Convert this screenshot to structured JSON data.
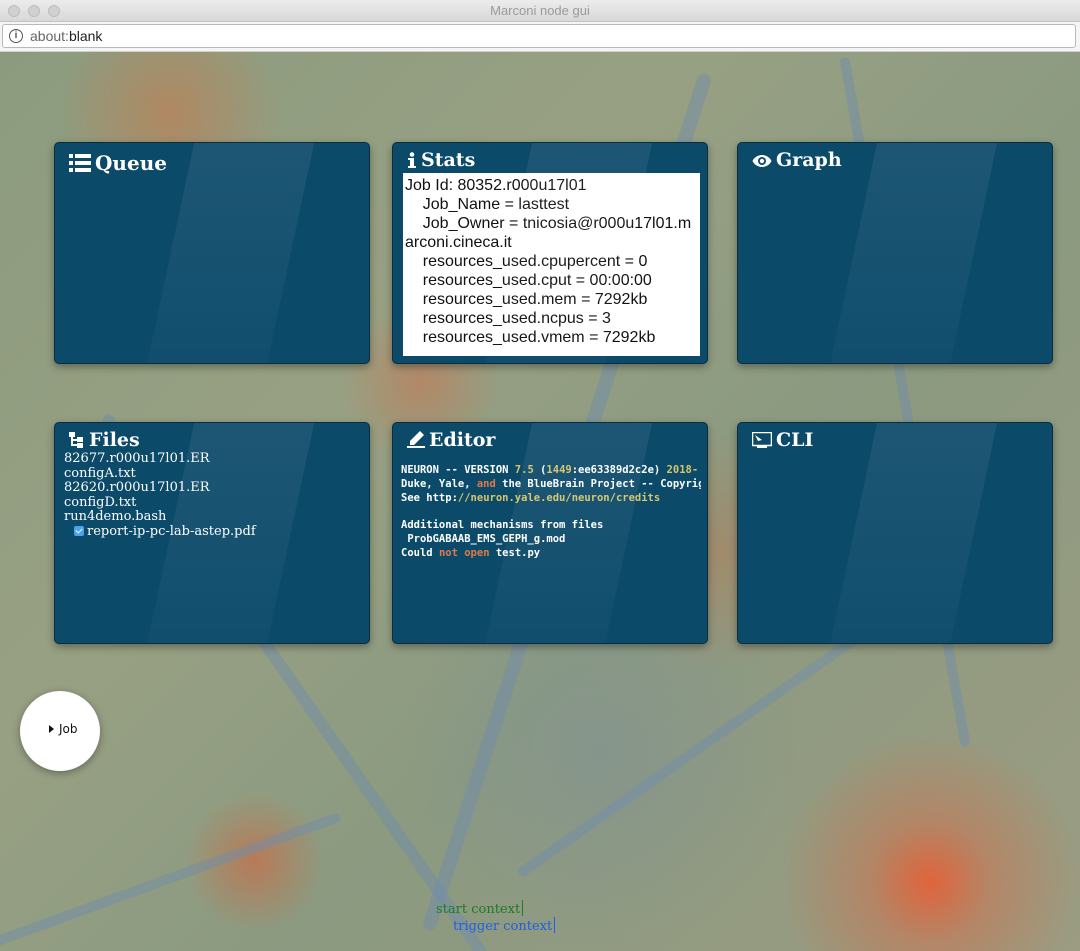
{
  "window": {
    "title": "Marconi node gui"
  },
  "address_bar": {
    "scheme": "about:",
    "path": "blank"
  },
  "panels": {
    "queue": {
      "title": "Queue"
    },
    "stats": {
      "title": "Stats",
      "lines": [
        "Job Id: 80352.r000u17l01",
        "    Job_Name = lasttest",
        "    Job_Owner = tnicosia@r000u17l01.marconi.cineca.it",
        "    resources_used.cpupercent = 0",
        "    resources_used.cput = 00:00:00",
        "    resources_used.mem = 7292kb",
        "    resources_used.ncpus = 3",
        "    resources_used.vmem = 7292kb"
      ]
    },
    "graph": {
      "title": "Graph"
    },
    "files": {
      "title": "Files",
      "items": [
        "82677.r000u17l01.ER",
        "configA.txt",
        "82620.r000u17l01.ER",
        "configD.txt",
        "run4demo.bash"
      ],
      "checked_item": "report-ip-pc-lab-astep.pdf"
    },
    "editor": {
      "title": "Editor",
      "line1": {
        "a": "NEURON -- VERSION ",
        "b": "7.5",
        "c": " (",
        "d": "1449",
        "e": ":ee63389d2c2e) ",
        "f": "2018-"
      },
      "line2": {
        "a": "Duke, Yale, ",
        "b": "and",
        "c": " the BlueBrain Project -- Copyright"
      },
      "line3": {
        "a": "See http:",
        "b": "//neuron.yale.edu/neuron/credits"
      },
      "line5": "Additional mechanisms from files",
      "line6": " ProbGABAAB_EMS_GEPH_g.mod",
      "line7": {
        "a": "Could ",
        "b": "not",
        "c": " ",
        "d": "open",
        "e": " test.py"
      }
    },
    "cli": {
      "title": "CLI"
    }
  },
  "fab": {
    "label": "Job"
  },
  "context": {
    "start": "start context",
    "trigger": "trigger context"
  },
  "colors": {
    "panel": "#0c4a6a",
    "start_context": "#1e7a2a",
    "trigger_context": "#1f5fe0"
  }
}
